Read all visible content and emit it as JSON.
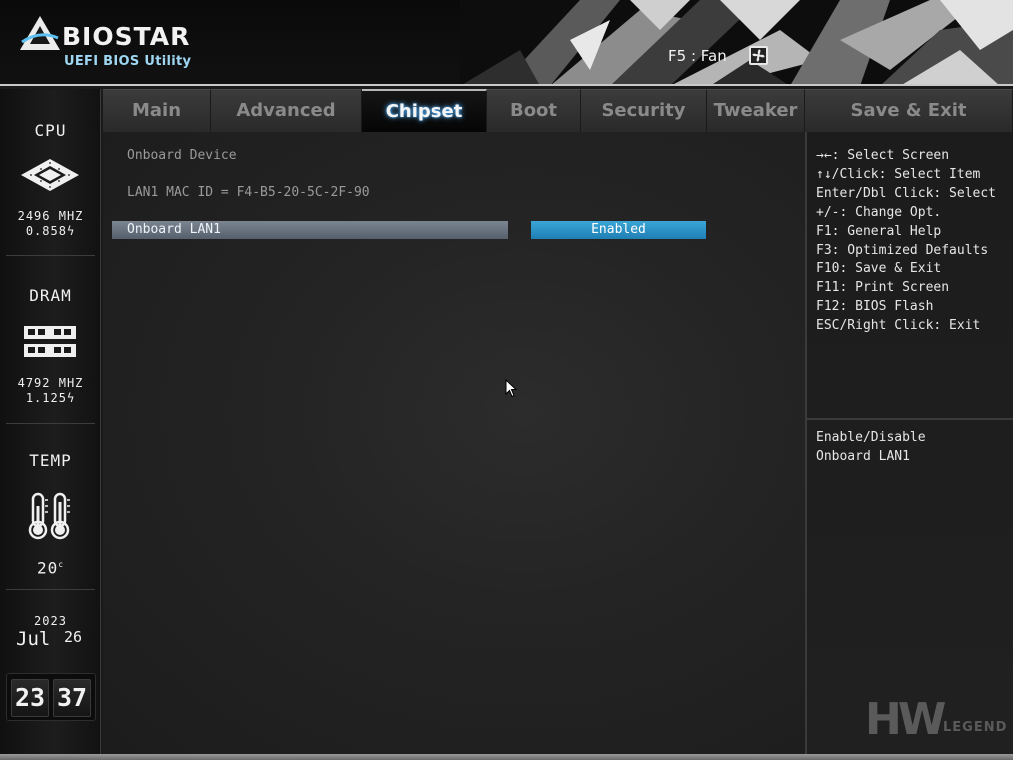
{
  "header": {
    "brand": "BIOSTAR",
    "subtitle": "UEFI BIOS Utility",
    "fan_hint": "F5 : Fan",
    "logo_icon": "biostar-logo-icon",
    "fan_icon": "fan-icon"
  },
  "sidebar": {
    "cpu": {
      "label": "CPU",
      "freq": "2496 MHZ",
      "volt": "0.858",
      "icon": "cpu-chip-icon"
    },
    "dram": {
      "label": "DRAM",
      "freq": "4792 MHZ",
      "volt": "1.125",
      "icon": "memory-module-icon"
    },
    "temp": {
      "label": "TEMP",
      "value": "20",
      "unit": "c",
      "icon": "thermometer-icon"
    },
    "date": {
      "year": "2023",
      "month": "Jul",
      "day": "26"
    },
    "time": {
      "hours": "23",
      "minutes": "37"
    }
  },
  "tabs": [
    {
      "label": "Main"
    },
    {
      "label": "Advanced"
    },
    {
      "label": "Chipset",
      "active": true
    },
    {
      "label": "Boot"
    },
    {
      "label": "Security"
    },
    {
      "label": "Tweaker"
    },
    {
      "label": "Save & Exit"
    }
  ],
  "main": {
    "section_title": "Onboard Device",
    "mac_line": "LAN1 MAC ID = F4-B5-20-5C-2F-90",
    "option_label": "Onboard LAN1",
    "option_value": "Enabled"
  },
  "help": {
    "keys": [
      "→←: Select Screen",
      "↑↓/Click: Select Item",
      "Enter/Dbl Click: Select",
      "+/-: Change Opt.",
      "F1: General Help",
      "F3: Optimized Defaults",
      "F10: Save & Exit",
      "F11: Print Screen",
      "F12: BIOS Flash",
      "ESC/Right Click: Exit"
    ],
    "description": [
      "Enable/Disable",
      "Onboard LAN1"
    ]
  },
  "watermark": {
    "big": "HW",
    "small": "LEGEND"
  },
  "colors": {
    "accent_blue": "#2b94c8",
    "selected_row": "#6a7580",
    "active_tab_glow": "#5ab4ff"
  }
}
